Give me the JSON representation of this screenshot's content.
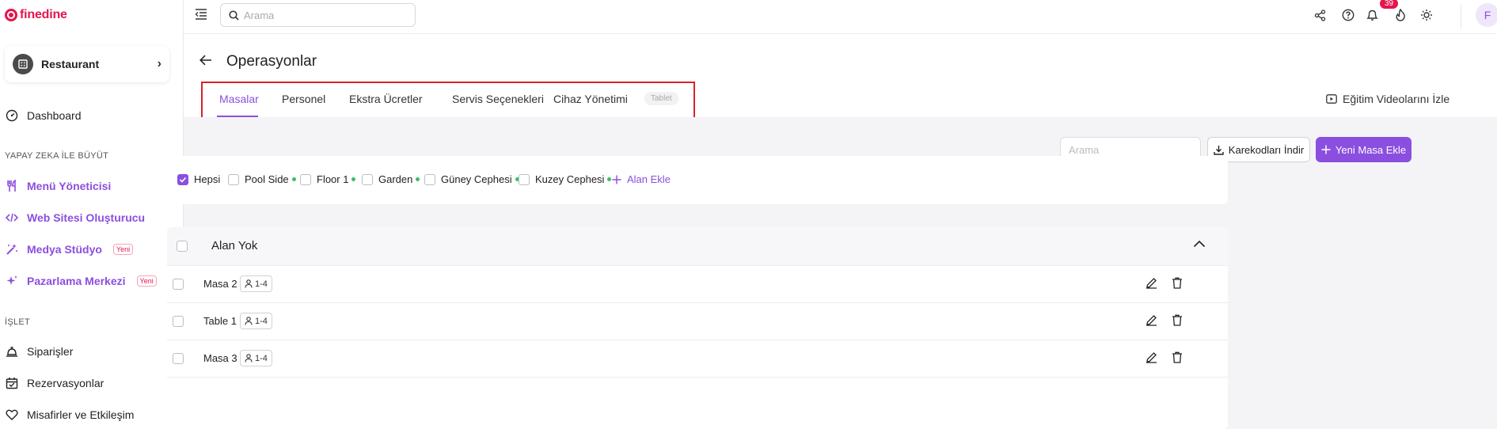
{
  "brand": {
    "name": "finedine",
    "color": "#e4164d"
  },
  "accent_color": "#8b4fe0",
  "sidebar": {
    "restaurant_label": "Restaurant",
    "dashboard_label": "Dashboard",
    "section_ai": "YAPAY ZEKA İLE BÜYÜT",
    "ai_items": [
      {
        "label": "Menü Yöneticisi",
        "icon": "utensils-icon"
      },
      {
        "label": "Web Sitesi Oluşturucu",
        "icon": "code-icon"
      },
      {
        "label": "Medya Stüdyo",
        "icon": "magic-wand-icon",
        "badge": "Yeni"
      },
      {
        "label": "Pazarlama Merkezi",
        "icon": "sparkles-icon",
        "badge": "Yeni"
      }
    ],
    "section_business": "İŞLET",
    "business_items": [
      {
        "label": "Siparişler",
        "icon": "bell-service-icon"
      },
      {
        "label": "Rezervasyonlar",
        "icon": "calendar-check-icon"
      },
      {
        "label": "Misafirler ve Etkileşim",
        "icon": "heart-icon"
      }
    ]
  },
  "topbar": {
    "search_placeholder": "Arama",
    "notification_count": "39",
    "avatar_initial": "F"
  },
  "page": {
    "title": "Operasyonlar",
    "tabs": [
      {
        "label": "Masalar",
        "active": true
      },
      {
        "label": "Personel"
      },
      {
        "label": "Ekstra Ücretler"
      },
      {
        "label": "Servis Seçenekleri"
      },
      {
        "label": "Cihaz Yönetimi",
        "badge": "Tablet"
      }
    ],
    "edu_videos_label": "Eğitim Videolarını İzle"
  },
  "toolbar": {
    "search_placeholder": "Arama",
    "qr_download_label": "Karekodları İndir",
    "new_table_label": "Yeni Masa Ekle"
  },
  "filters": {
    "all_label": "Hepsi",
    "all_checked": true,
    "areas": [
      "Pool Side",
      "Floor 1",
      "Garden",
      "Güney Cephesi",
      "Kuzey Cephesi"
    ],
    "add_area_label": "Alan Ekle"
  },
  "table_group": {
    "name": "Alan Yok",
    "rows": [
      {
        "name": "Masa 2",
        "capacity": "1-4"
      },
      {
        "name": "Table 1",
        "capacity": "1-4"
      },
      {
        "name": "Masa 3",
        "capacity": "1-4"
      }
    ]
  }
}
